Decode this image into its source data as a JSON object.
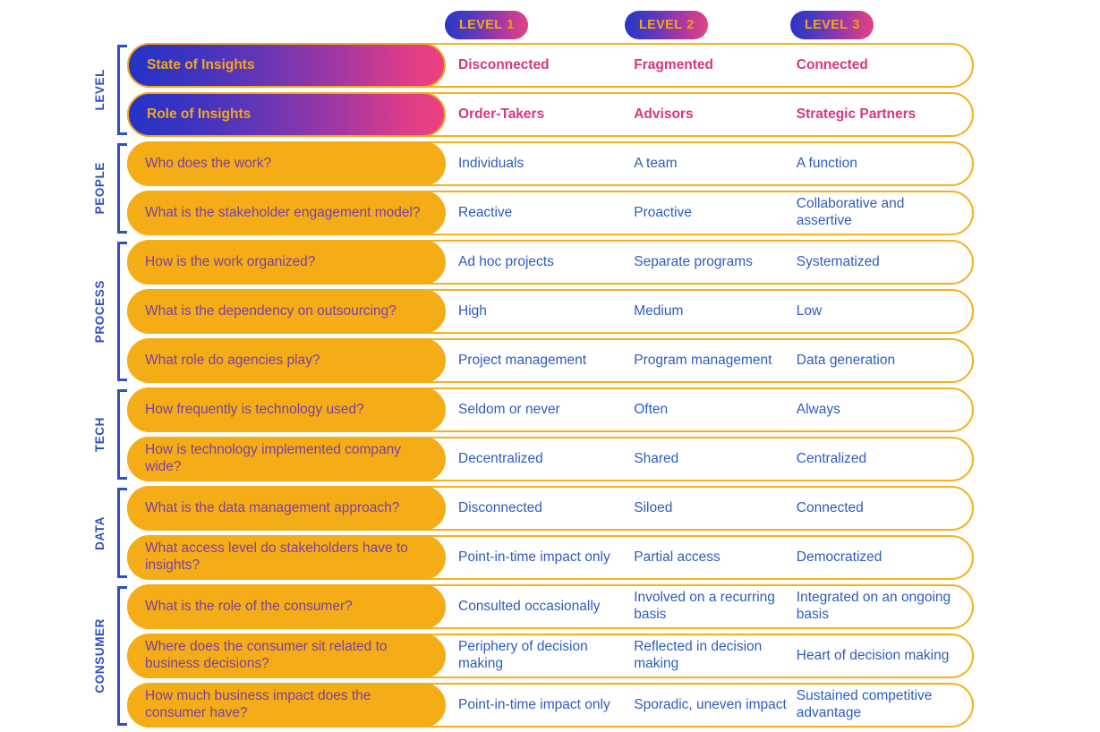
{
  "header": {
    "levels": [
      {
        "word": "LEVEL",
        "number": "1"
      },
      {
        "word": "LEVEL",
        "number": "2"
      },
      {
        "word": "LEVEL",
        "number": "3"
      }
    ]
  },
  "colors": {
    "orange_pill": "#f5ad17",
    "orange_border": "#f5b01a",
    "blue_text": "#2f5cbf",
    "purple_text": "#7a3fa3",
    "pink_text": "#d8367f",
    "badge_gradient_start": "#2433c6",
    "badge_gradient_end": "#ee4080",
    "bracket_blue": "#2f4fc7",
    "badge_label_orange": "#f0a81e"
  },
  "sections": [
    {
      "label": "LEVEL",
      "highlight": true,
      "rows": [
        {
          "question": "State of Insights",
          "values": [
            "Disconnected",
            "Fragmented",
            "Connected"
          ]
        },
        {
          "question": "Role of Insights",
          "values": [
            "Order-Takers",
            "Advisors",
            "Strategic Partners"
          ]
        }
      ]
    },
    {
      "label": "PEOPLE",
      "highlight": false,
      "rows": [
        {
          "question": "Who does the work?",
          "values": [
            "Individuals",
            "A team",
            "A function"
          ]
        },
        {
          "question": "What is the stakeholder engagement model?",
          "values": [
            "Reactive",
            "Proactive",
            "Collaborative and assertive"
          ]
        }
      ]
    },
    {
      "label": "PROCESS",
      "highlight": false,
      "rows": [
        {
          "question": "How is the work organized?",
          "values": [
            "Ad hoc projects",
            "Separate programs",
            "Systematized"
          ]
        },
        {
          "question": "What is the dependency on outsourcing?",
          "values": [
            "High",
            "Medium",
            "Low"
          ]
        },
        {
          "question": "What role do agencies play?",
          "values": [
            "Project management",
            "Program management",
            "Data generation"
          ]
        }
      ]
    },
    {
      "label": "TECH",
      "highlight": false,
      "rows": [
        {
          "question": "How frequently is technology used?",
          "values": [
            "Seldom or never",
            "Often",
            "Always"
          ]
        },
        {
          "question": "How is technology implemented company wide?",
          "values": [
            "Decentralized",
            "Shared",
            "Centralized"
          ]
        }
      ]
    },
    {
      "label": "DATA",
      "highlight": false,
      "rows": [
        {
          "question": "What is the data management approach?",
          "values": [
            "Disconnected",
            "Siloed",
            "Connected"
          ]
        },
        {
          "question": "What access level do stakeholders have to insights?",
          "values": [
            "Point-in-time impact only",
            "Partial access",
            "Democratized"
          ]
        }
      ]
    },
    {
      "label": "CONSUMER",
      "highlight": false,
      "rows": [
        {
          "question": "What is the role of the consumer?",
          "values": [
            "Consulted occasionally",
            "Involved on a recurring basis",
            "Integrated on an ongoing basis"
          ]
        },
        {
          "question": "Where does the consumer sit related to business decisions?",
          "values": [
            "Periphery of decision making",
            "Reflected in decision making",
            "Heart of decision making"
          ]
        },
        {
          "question": "How much business impact does the consumer have?",
          "values": [
            "Point-in-time impact only",
            "Sporadic, uneven impact",
            "Sustained competitive advantage"
          ]
        }
      ]
    }
  ]
}
